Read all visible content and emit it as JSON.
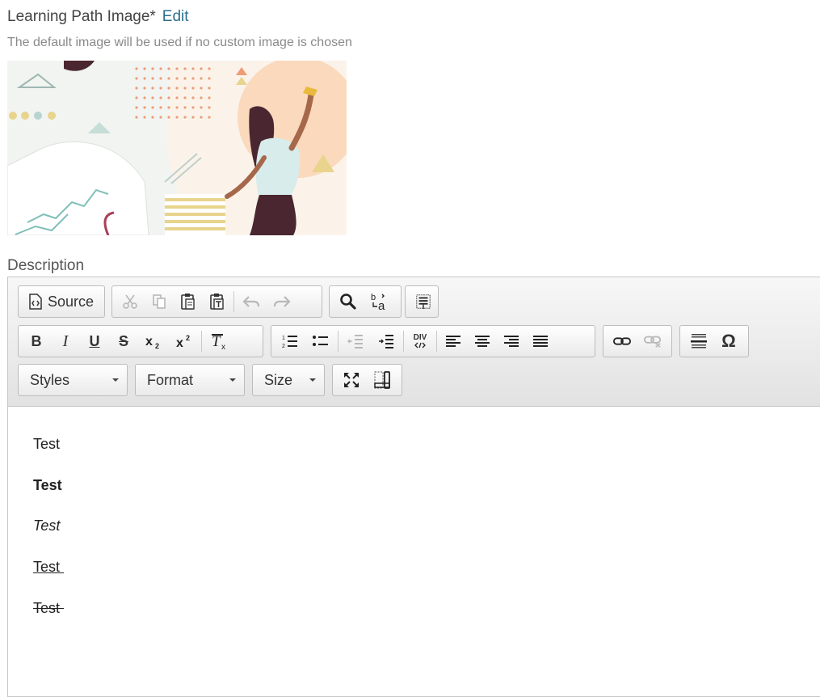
{
  "image_section": {
    "title": "Learning Path Image*",
    "edit_label": "Edit",
    "hint": "The default image will be used if no custom image is chosen"
  },
  "description_label": "Description",
  "toolbar": {
    "source_label": "Source",
    "styles_label": "Styles",
    "format_label": "Format",
    "size_label": "Size",
    "bold_glyph": "B",
    "italic_glyph": "I",
    "underline_glyph": "U",
    "strike_glyph": "S",
    "omega_glyph": "Ω",
    "div_glyph": "DIV"
  },
  "content": {
    "paragraphs": [
      "Test",
      "Test",
      "Test",
      "Test ",
      "Test "
    ]
  },
  "colors": {
    "link": "#2a6f8a",
    "hint_text": "#8a8a8a",
    "border": "#c7c7c7"
  }
}
